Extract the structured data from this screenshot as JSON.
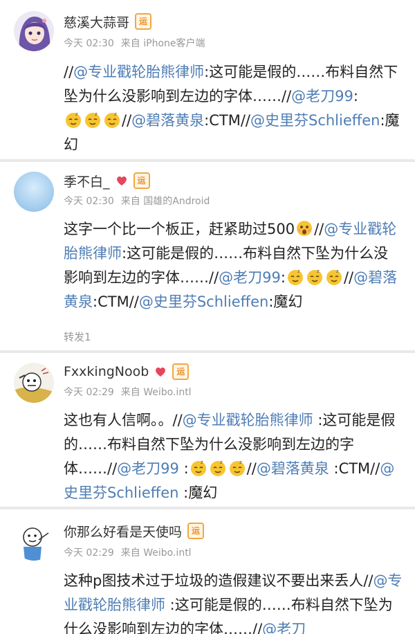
{
  "colors": {
    "mention": "#4e7db4",
    "meta": "#999999",
    "badge_border": "#f2a742",
    "vip_pink": "#e6455a"
  },
  "badge_text": "运",
  "posts": [
    {
      "username": "慈溪大蒜哥",
      "time": "今天 02:30",
      "source_prefix": "来自",
      "source": "iPhone客户端",
      "has_vip": false,
      "text": {
        "p1": "//",
        "m1": "@专业戳轮胎熊律师",
        "p2": ":这可能是假的……布料自然下坠为什么没影响到左边的字体……//",
        "m2": "@老刀99",
        "p3": ":",
        "p4": "//",
        "m3": "@碧落黄泉",
        "p5": ":CTM//",
        "m4": "@史里芬Schlieffen",
        "p6": ":魔幻"
      }
    },
    {
      "username": "季不白_",
      "time": "今天 02:30",
      "source_prefix": "来自",
      "source": "国雄的Android",
      "has_vip": true,
      "text": {
        "p1": "这字一个比一个板正，赶紧助过500",
        "p2": "//",
        "m1": "@专业戳轮胎熊律师",
        "p3": ":这可能是假的……布料自然下坠为什么没影响到左边的字体……//",
        "m2": "@老刀99",
        "p4": ":",
        "p5": "//",
        "m3": "@碧落黄泉",
        "p6": ":CTM//",
        "m4": "@史里芬Schlieffen",
        "p7": ":魔幻"
      },
      "repost": "转发1"
    },
    {
      "username": "FxxkingNoob",
      "time": "今天 02:29",
      "source_prefix": "来自",
      "source": "Weibo.intl",
      "has_vip": true,
      "text": {
        "p1": "这也有人信啊。。//",
        "m1": "@专业戳轮胎熊律师",
        "p2": " :这可能是假的……布料自然下坠为什么没影响到左边的字体……//",
        "m2": "@老刀99",
        "p3": " :",
        "p4": "//",
        "m3": "@碧落黄泉",
        "p5": " :CTM//",
        "m4": "@史里芬Schlieffen",
        "p6": " :魔幻"
      }
    },
    {
      "username": "你那么好看是天使吗",
      "time": "今天 02:29",
      "source_prefix": "来自",
      "source": "Weibo.intl",
      "has_vip": false,
      "text": {
        "p1": "这种p图技术过于垃圾的造假建议不要出来丢人//",
        "m1": "@专业戳轮胎熊律师",
        "p2": " :这可能是假的……布料自然下坠为什么没影响到左边的字体……//",
        "m2": "@老刀"
      }
    }
  ]
}
